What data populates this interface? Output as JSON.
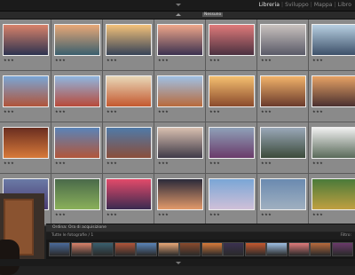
{
  "modules": [
    {
      "label": "Libreria",
      "active": true
    },
    {
      "label": "Sviluppo",
      "active": false
    },
    {
      "label": "Mappa",
      "active": false
    },
    {
      "label": "Libro",
      "active": false
    }
  ],
  "filter_label": "Nessuno",
  "grid": {
    "rows": 4,
    "cols": 7,
    "cells": [
      {
        "num": "",
        "stars": "★★★",
        "c1": "#d9826a",
        "c2": "#2d3350"
      },
      {
        "num": "",
        "stars": "★★★",
        "c1": "#e9a877",
        "c2": "#3a5f6e"
      },
      {
        "num": "",
        "stars": "★★★",
        "c1": "#f4c27a",
        "c2": "#364257"
      },
      {
        "num": "",
        "stars": "★★★",
        "c1": "#f0a78a",
        "c2": "#3b3150"
      },
      {
        "num": "",
        "stars": "★★★",
        "c1": "#e07a7a",
        "c2": "#4b3140"
      },
      {
        "num": "",
        "stars": "★★★",
        "c1": "#c9c2be",
        "c2": "#5a5a68"
      },
      {
        "num": "",
        "stars": "★★★",
        "c1": "#b8d0e2",
        "c2": "#3d5069"
      },
      {
        "num": "",
        "stars": "★★★",
        "c1": "#7aa6d6",
        "c2": "#b0543a"
      },
      {
        "num": "",
        "stars": "★★★",
        "c1": "#8fb6e0",
        "c2": "#b84a3a"
      },
      {
        "num": "",
        "stars": "★★★",
        "c1": "#e8d8b8",
        "c2": "#c4582f"
      },
      {
        "num": "",
        "stars": "★★★",
        "c1": "#9fc0e4",
        "c2": "#b86a3c"
      },
      {
        "num": "",
        "stars": "★★★",
        "c1": "#f5c070",
        "c2": "#8a4a2c"
      },
      {
        "num": "",
        "stars": "★★★",
        "c1": "#f2b36a",
        "c2": "#6a3a2c"
      },
      {
        "num": "",
        "stars": "★★★",
        "c1": "#e7a265",
        "c2": "#4a3030"
      },
      {
        "num": "",
        "stars": "★★★",
        "c1": "#6a2e20",
        "c2": "#d87a3a"
      },
      {
        "num": "",
        "stars": "★★★",
        "c1": "#5a84b8",
        "c2": "#b2563a"
      },
      {
        "num": "",
        "stars": "★★★",
        "c1": "#4f7aa8",
        "c2": "#8a4e3a"
      },
      {
        "num": "",
        "stars": "★★★",
        "c1": "#d9c0b0",
        "c2": "#3f3a48"
      },
      {
        "num": "",
        "stars": "★★★",
        "c1": "#8fa0b8",
        "c2": "#6a3a6a"
      },
      {
        "num": "",
        "stars": "★★★",
        "c1": "#9aa8b8",
        "c2": "#3b4a3a"
      },
      {
        "num": "",
        "stars": "★★★",
        "c1": "#f0f0f0",
        "c2": "#5a6a5a"
      },
      {
        "num": "",
        "stars": "★★★",
        "c1": "#6a7aa6",
        "c2": "#4a3a70"
      },
      {
        "num": "",
        "stars": "★★★",
        "c1": "#4a6a4a",
        "c2": "#8ab05a"
      },
      {
        "num": "",
        "stars": "★★★",
        "c1": "#e34a6a",
        "c2": "#3a2a50"
      },
      {
        "num": "",
        "stars": "★★★",
        "c1": "#2a2a3a",
        "c2": "#e39a6a"
      },
      {
        "num": "",
        "stars": "★★★",
        "c1": "#7aa6d6",
        "c2": "#d0c0d8"
      },
      {
        "num": "",
        "stars": "★★★",
        "c1": "#6a8ab0",
        "c2": "#a0b0c0"
      },
      {
        "num": "",
        "stars": "★★★",
        "c1": "#4a7a3a",
        "c2": "#c0a040"
      }
    ]
  },
  "toolbar": {
    "label": "Ordina: Ora di acquisizione",
    "sort": "",
    "swatches": [
      "#e74c3c",
      "#f1c40f",
      "#2ecc71",
      "#3498db",
      "#9b59b6"
    ]
  },
  "filmstrip": {
    "path": "Tutte le fotografie / 1",
    "right": "Filtro:",
    "thumbs": [
      "#4a6a9a",
      "#d9826a",
      "#3a5f6e",
      "#b0543a",
      "#5a84b8",
      "#e9a877",
      "#8a4a2c",
      "#d87a3a",
      "#3b3150",
      "#c4582f",
      "#9fc0e4",
      "#e07a7a",
      "#b86a3c",
      "#6a3a6a"
    ]
  }
}
